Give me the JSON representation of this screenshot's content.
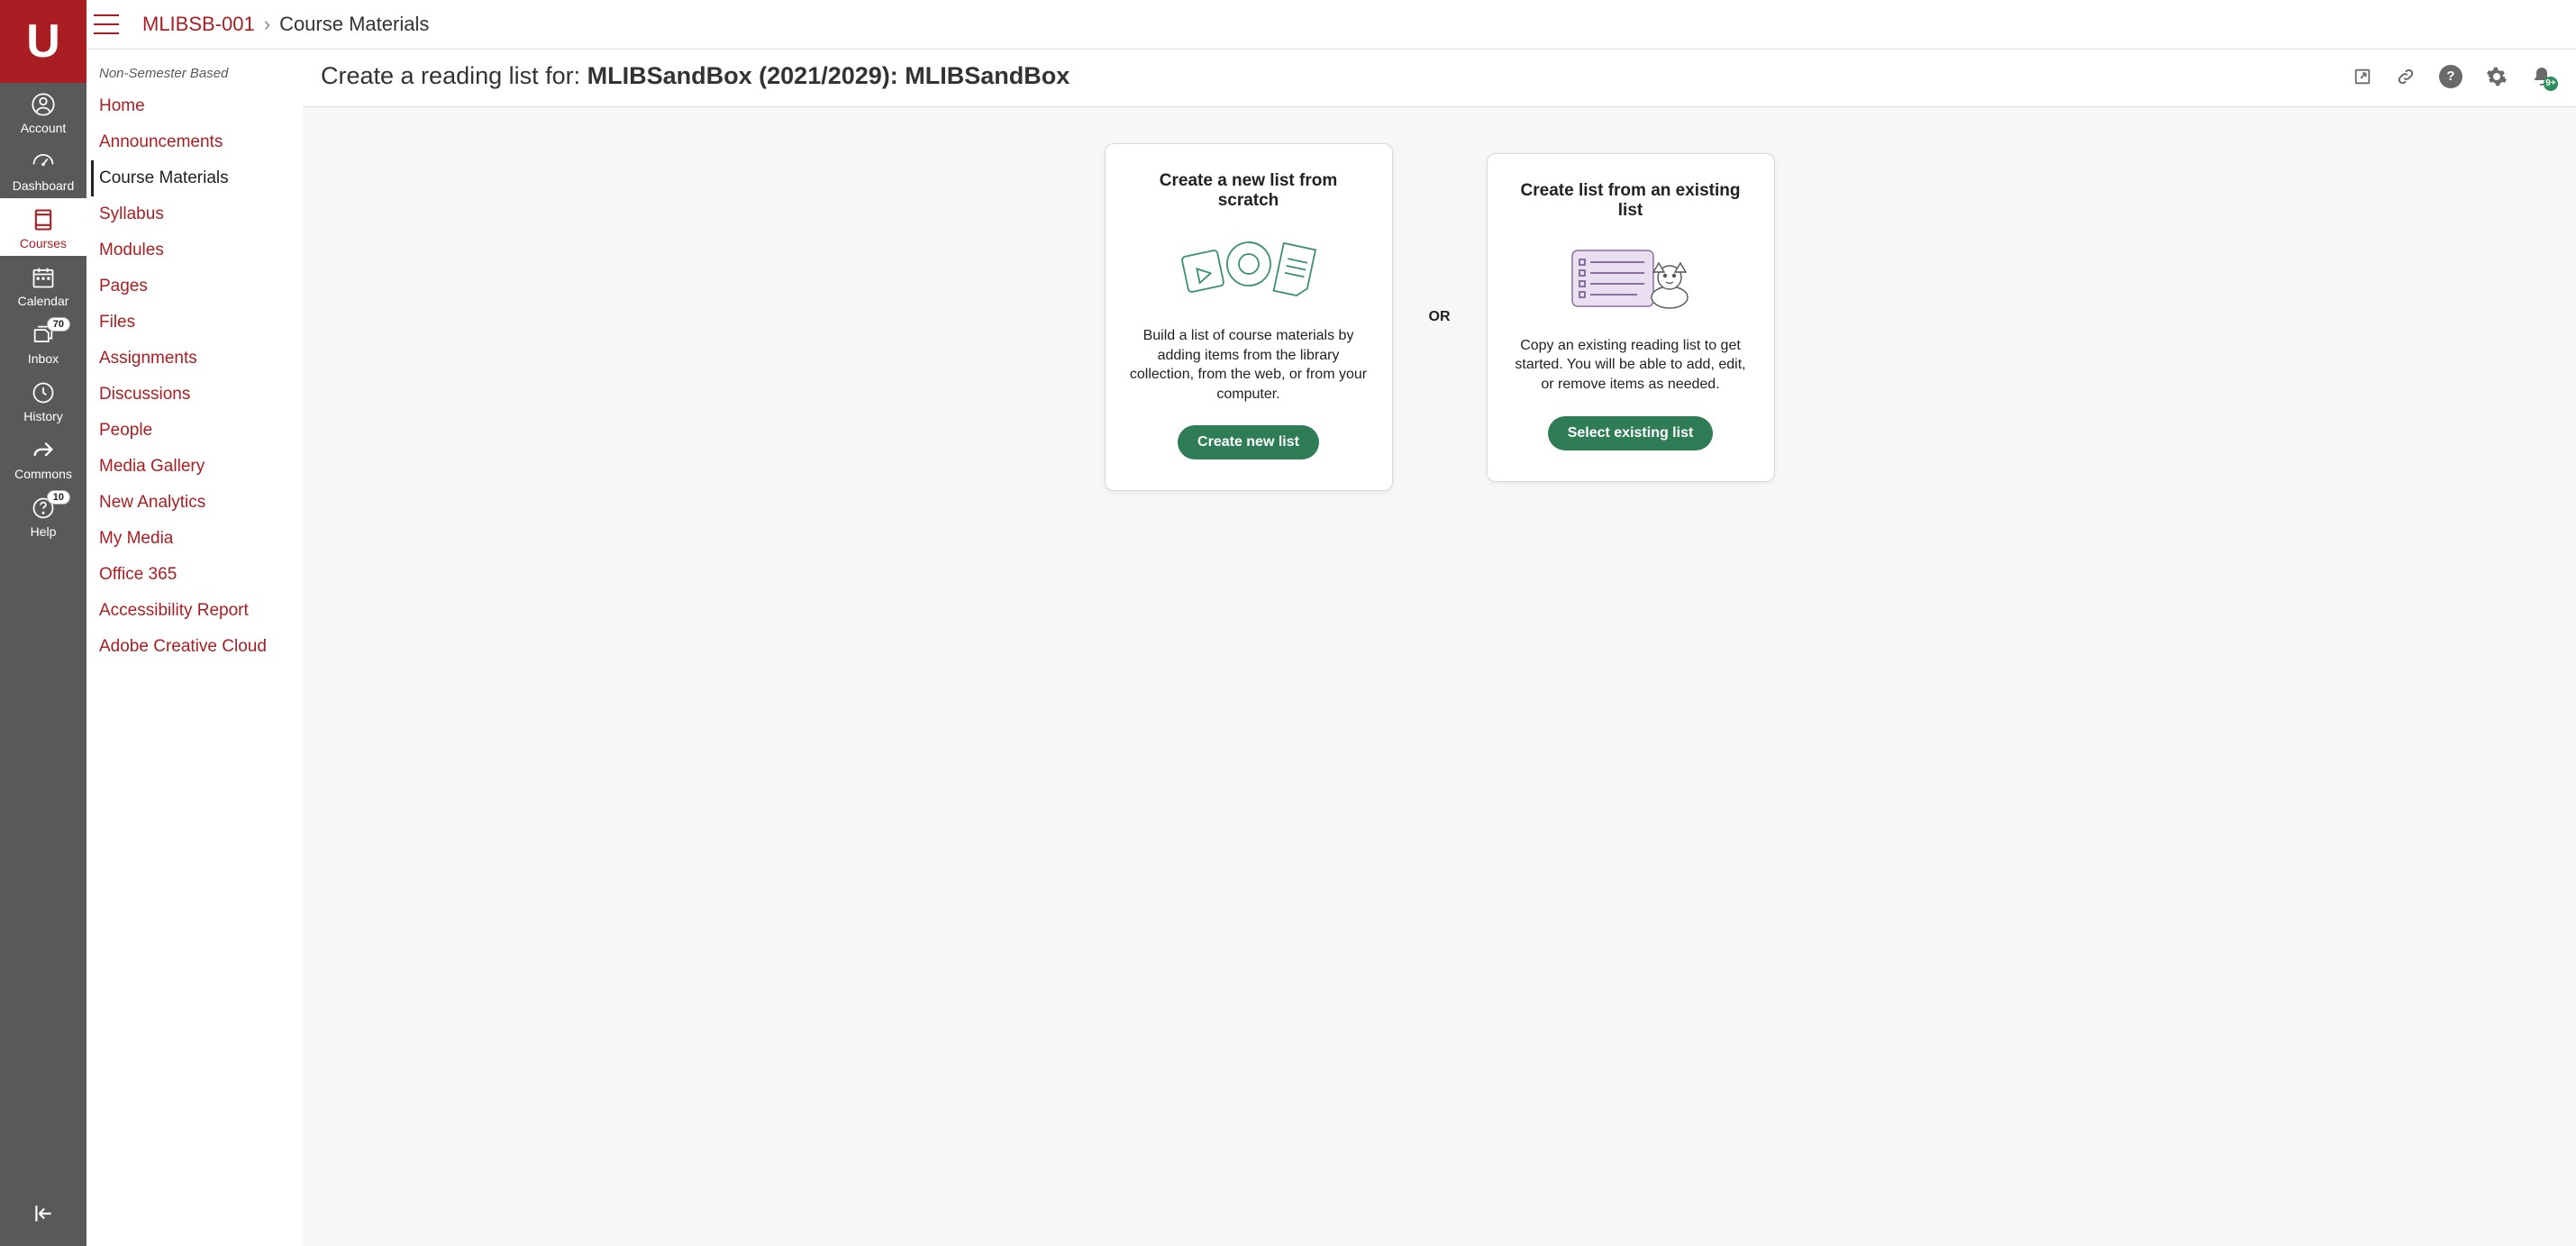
{
  "brand": {
    "letter": "U"
  },
  "globalNav": {
    "items": [
      {
        "key": "account",
        "label": "Account"
      },
      {
        "key": "dashboard",
        "label": "Dashboard"
      },
      {
        "key": "courses",
        "label": "Courses",
        "active": true
      },
      {
        "key": "calendar",
        "label": "Calendar"
      },
      {
        "key": "inbox",
        "label": "Inbox",
        "badge": "70"
      },
      {
        "key": "history",
        "label": "History"
      },
      {
        "key": "commons",
        "label": "Commons"
      },
      {
        "key": "help",
        "label": "Help",
        "badge": "10"
      }
    ]
  },
  "breadcrumb": {
    "course": "MLIBSB-001",
    "separator": "›",
    "current": "Course Materials"
  },
  "courseNav": {
    "term": "Non-Semester Based",
    "items": [
      {
        "label": "Home"
      },
      {
        "label": "Announcements"
      },
      {
        "label": "Course Materials",
        "active": true
      },
      {
        "label": "Syllabus"
      },
      {
        "label": "Modules"
      },
      {
        "label": "Pages"
      },
      {
        "label": "Files"
      },
      {
        "label": "Assignments"
      },
      {
        "label": "Discussions"
      },
      {
        "label": "People"
      },
      {
        "label": "Media Gallery"
      },
      {
        "label": "New Analytics"
      },
      {
        "label": "My Media"
      },
      {
        "label": "Office 365"
      },
      {
        "label": "Accessibility Report"
      },
      {
        "label": "Adobe Creative Cloud"
      }
    ]
  },
  "tool": {
    "titlePrefix": "Create a reading list for: ",
    "titleBold": "MLIBSandBox (2021/2029): MLIBSandBox",
    "notificationBadge": "9+",
    "divider": "OR",
    "cardNew": {
      "heading": "Create a new list from scratch",
      "desc": "Build a list of course materials by adding items from the library collection, from the web, or from your computer.",
      "button": "Create new list"
    },
    "cardExisting": {
      "heading": "Create list from an existing list",
      "desc": "Copy an existing reading list to get started. You will be able to add, edit, or remove items as needed.",
      "button": "Select existing list"
    }
  }
}
